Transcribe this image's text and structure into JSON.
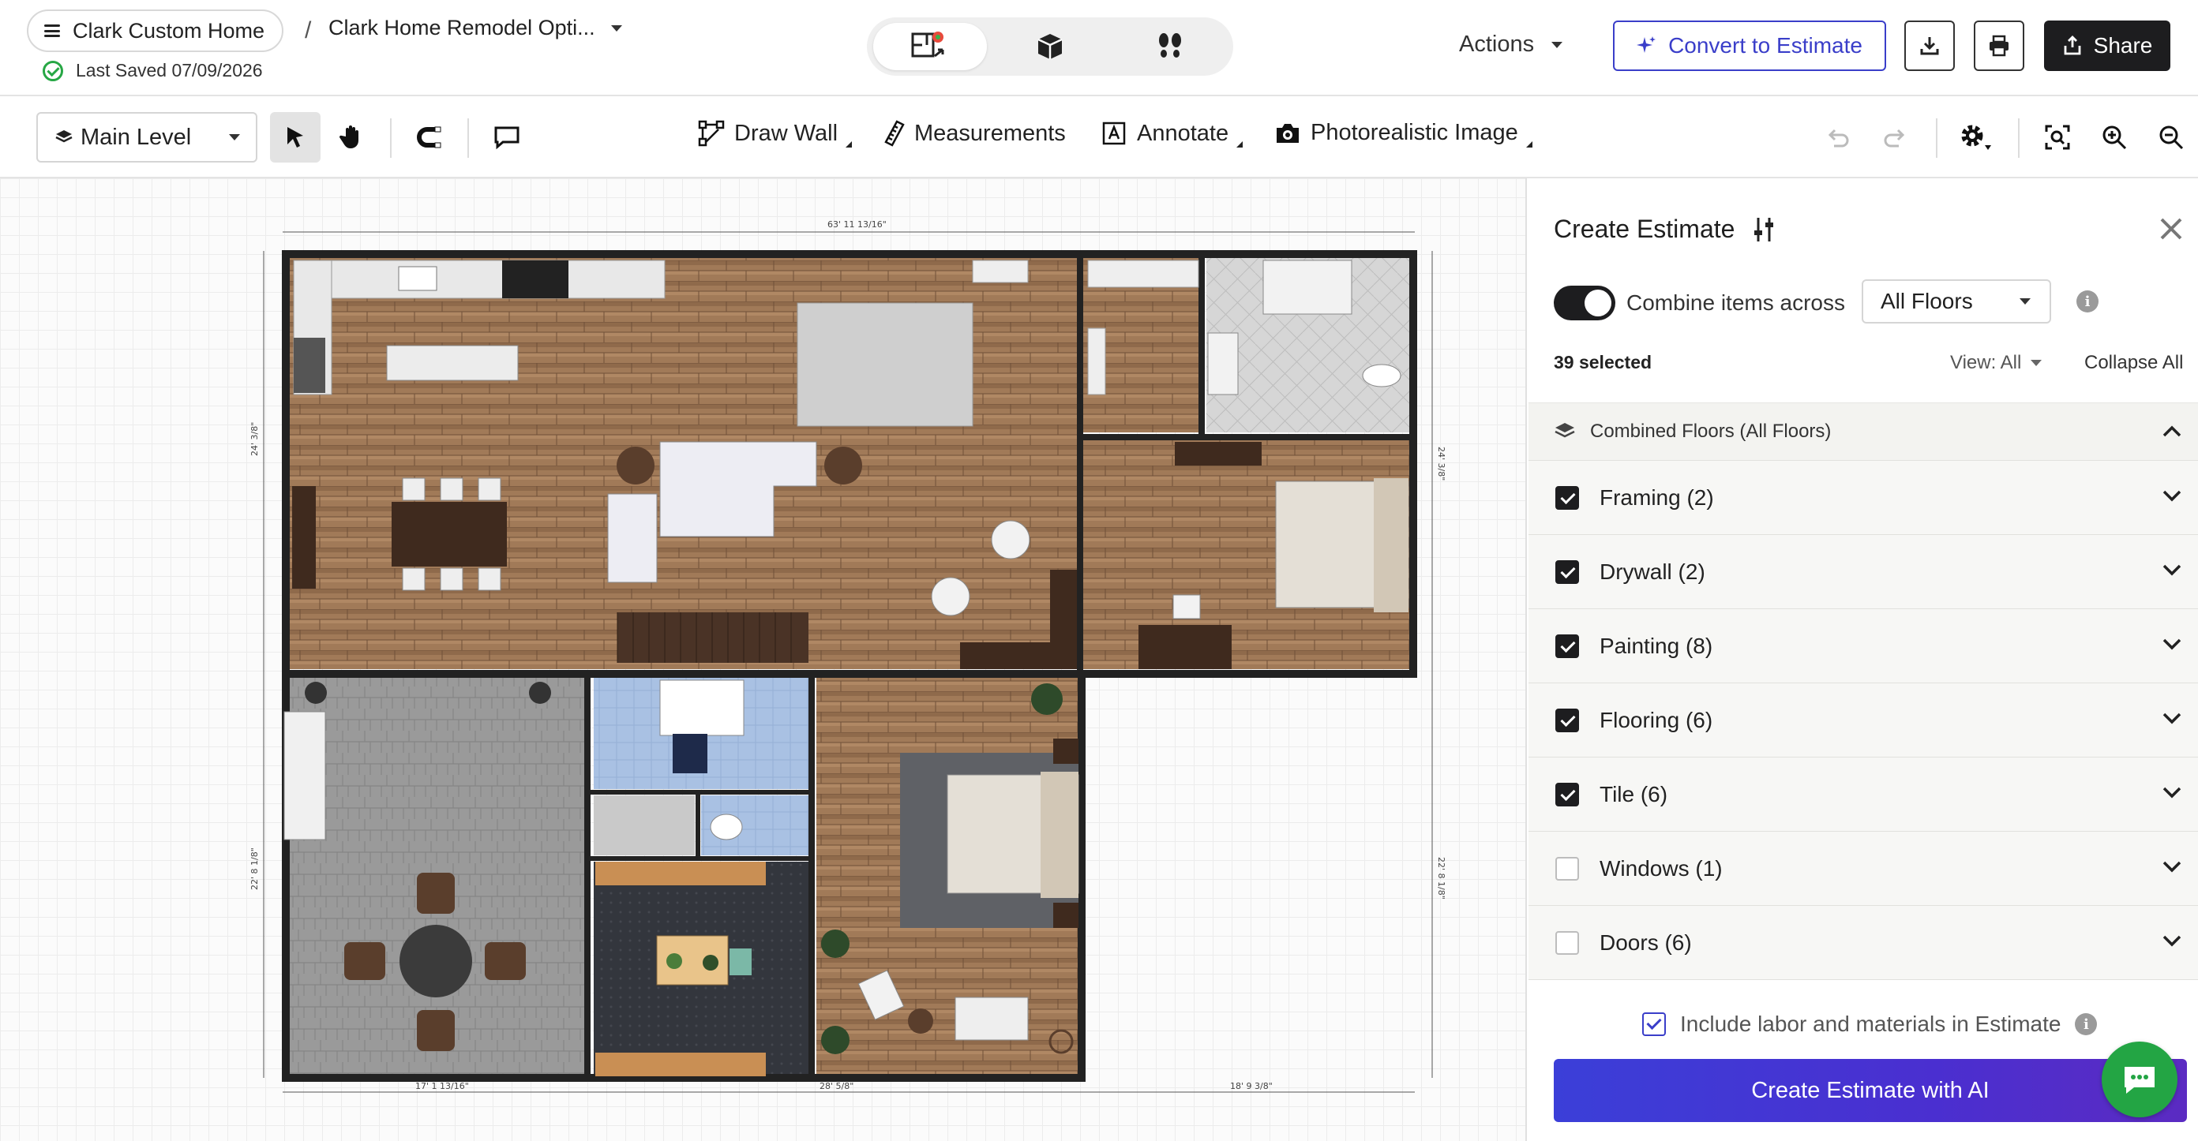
{
  "header": {
    "project_name": "Clark Custom Home",
    "crumb_separator": "/",
    "document_title": "Clark Home Remodel Opti...",
    "last_saved": "Last Saved 07/09/2026",
    "actions_label": "Actions",
    "convert_label": "Convert to Estimate",
    "share_label": "Share",
    "view_modes": [
      "floorplan-2d-icon",
      "3d-box-icon",
      "walkthrough-icon"
    ]
  },
  "toolbar": {
    "level": "Main Level",
    "draw_wall": "Draw Wall",
    "measurements": "Measurements",
    "annotate": "Annotate",
    "photoreal": "Photorealistic Image"
  },
  "floorplan": {
    "dims": {
      "top": "63' 11 13/16\"",
      "left_upper": "24' 3/8\"",
      "left_lower": "22' 8 1/8\"",
      "right_upper": "24' 3/8\"",
      "right_lower": "22' 8 1/8\"",
      "bottom_1": "17' 1 13/16\"",
      "bottom_2": "28' 5/8\"",
      "bottom_3": "18' 9 3/8\""
    }
  },
  "panel": {
    "title": "Create Estimate",
    "combine_label": "Combine items across",
    "combine_on": true,
    "floor_select": "All Floors",
    "selected_count": "39 selected",
    "view_filter": "View: All",
    "collapse_all": "Collapse All",
    "group_label": "Combined Floors (All Floors)",
    "categories": [
      {
        "label": "Framing (2)",
        "checked": true
      },
      {
        "label": "Drywall (2)",
        "checked": true
      },
      {
        "label": "Painting (8)",
        "checked": true
      },
      {
        "label": "Flooring (6)",
        "checked": true
      },
      {
        "label": "Tile (6)",
        "checked": true
      },
      {
        "label": "Windows (1)",
        "checked": false
      },
      {
        "label": "Doors (6)",
        "checked": false
      }
    ],
    "include_labor": "Include labor and materials in Estimate",
    "create_button": "Create Estimate with AI"
  },
  "colors": {
    "accent": "#3a3ec9",
    "dark": "#1d1d1f",
    "success": "#27a745",
    "wood": "#9a7251",
    "stone": "#8e8e8e"
  }
}
